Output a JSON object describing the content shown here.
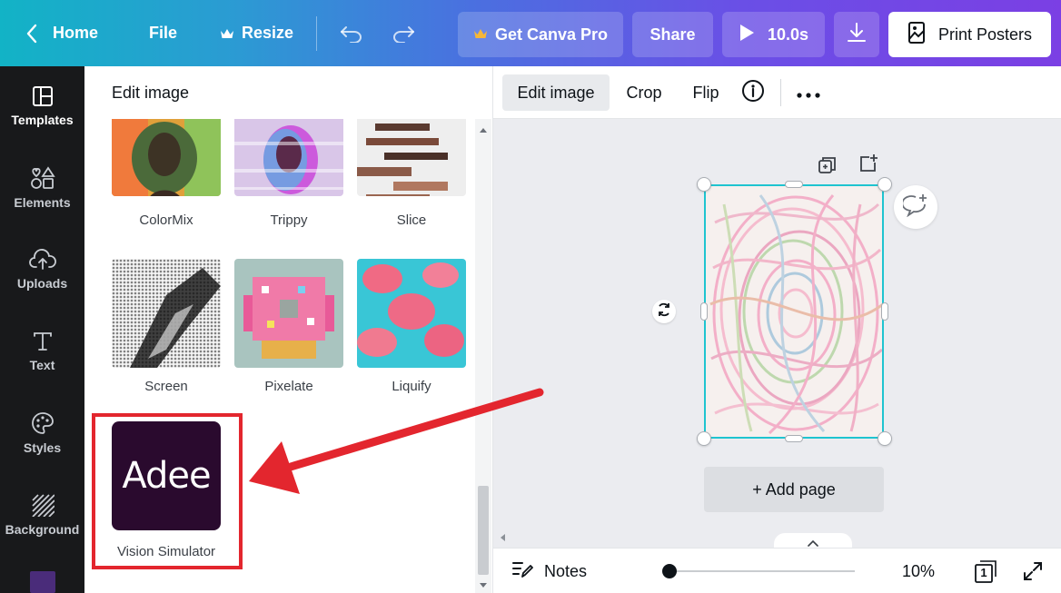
{
  "topbar": {
    "home": "Home",
    "file": "File",
    "resize": "Resize",
    "get_pro": "Get Canva Pro",
    "share": "Share",
    "duration": "10.0s",
    "print": "Print Posters"
  },
  "rail": {
    "items": [
      {
        "label": "Templates",
        "icon": "layout-icon"
      },
      {
        "label": "Elements",
        "icon": "shapes-icon"
      },
      {
        "label": "Uploads",
        "icon": "cloud-upload-icon"
      },
      {
        "label": "Text",
        "icon": "text-icon"
      },
      {
        "label": "Styles",
        "icon": "palette-icon"
      },
      {
        "label": "Background",
        "icon": "hatch-icon"
      }
    ]
  },
  "panel": {
    "title": "Edit image",
    "effects": [
      {
        "label": "ColorMix"
      },
      {
        "label": "Trippy"
      },
      {
        "label": "Slice"
      },
      {
        "label": "Screen"
      },
      {
        "label": "Pixelate"
      },
      {
        "label": "Liquify"
      },
      {
        "label": "Vision Simulator",
        "logo_text": "Adee"
      }
    ]
  },
  "context_toolbar": {
    "edit_image": "Edit image",
    "crop": "Crop",
    "flip": "Flip"
  },
  "canvas": {
    "add_page": "+ Add page"
  },
  "bottombar": {
    "notes": "Notes",
    "zoom": "10%",
    "zoom_fraction": 0.1,
    "page_count": "1"
  },
  "colors": {
    "accent_cyan": "#1fc4d0",
    "annotation_red": "#e3262e",
    "rail_bg": "#18191b",
    "adee_bg": "#2a0a2e"
  }
}
